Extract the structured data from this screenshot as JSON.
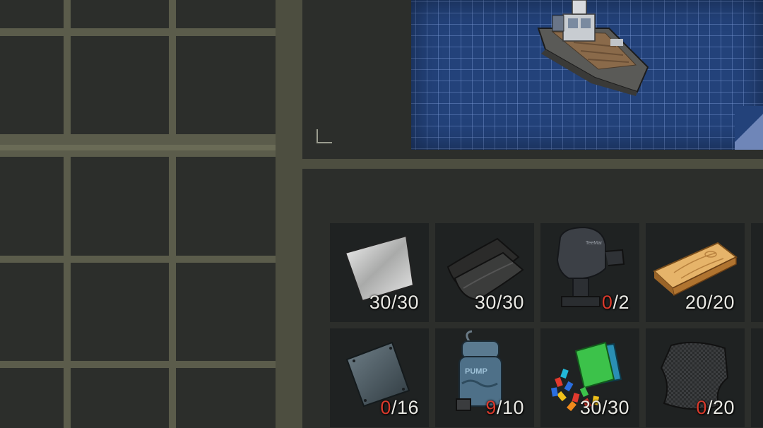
{
  "inventory": {
    "rows": 4,
    "columns": 3
  },
  "blueprint": {
    "item_icon": "boat-icon",
    "background_color": "#23427a"
  },
  "recipe": {
    "ingredients": [
      {
        "icon": "metal-sheet-icon",
        "have": "30",
        "need": "30"
      },
      {
        "icon": "leather-icon",
        "have": "30",
        "need": "30"
      },
      {
        "icon": "outboard-motor-icon",
        "have": "0",
        "need": "2"
      },
      {
        "icon": "wood-plank-icon",
        "have": "20",
        "need": "20"
      },
      {
        "icon": "steel-plate-icon",
        "have": "0",
        "need": "16"
      },
      {
        "icon": "bilge-pump-icon",
        "have": "9",
        "need": "10"
      },
      {
        "icon": "plastic-parts-icon",
        "have": "30",
        "need": "30"
      },
      {
        "icon": "carbon-fabric-icon",
        "have": "0",
        "need": "20"
      }
    ],
    "pump_label": "PUMP",
    "motor_label": "TeeMar"
  },
  "colors": {
    "insufficient": "#d93a2c",
    "sufficient": "#e9e9e4"
  }
}
